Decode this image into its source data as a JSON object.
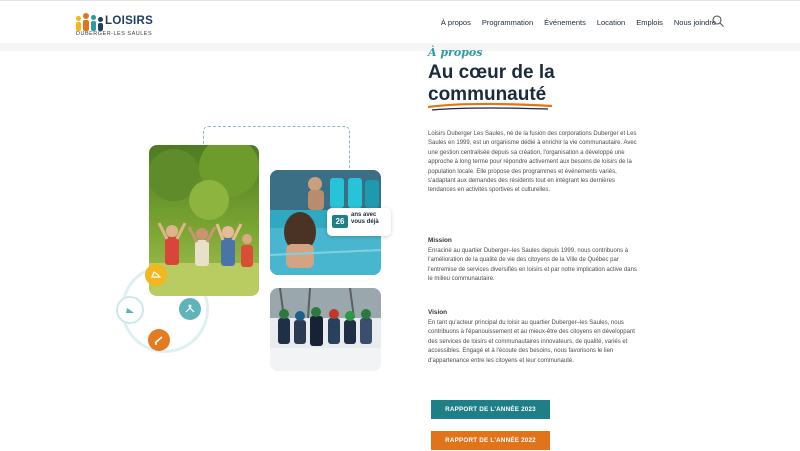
{
  "header": {
    "logo_title": "LOISIRS",
    "logo_subtitle": "DUBERGER-LES SAULES",
    "nav": [
      "À propos",
      "Programmation",
      "Événements",
      "Location",
      "Emplois",
      "Nous joindre"
    ]
  },
  "hero": {
    "eyebrow": "À propos",
    "title_line1": "Au cœur de la",
    "title_line2": "communauté",
    "intro": "Loisirs Duberger Les Saules, né de la fusion des corporations Duberger et Les Saules en 1999, est un organisme dédié à enrichir la vie communautaire. Avec une gestion centralisée depuis sa création, l'organisation a développé une approche à long terme pour répondre activement aux besoins de loisirs de la population locale. Elle propose des programmes et événements variés, s'adaptant aux demandes des résidents tout en intégrant les dernières tendances en activités sportives et culturelles.",
    "mission_heading": "Mission",
    "mission_text": "Enraciné au quartier Duberger–les Saules depuis 1999, nous contribuons à l'amélioration de la qualité de vie des citoyens de la Ville de Québec par l'entremise de services diversifiés en loisirs et par notre implication active dans le milieu communautaire.",
    "vision_heading": "Vision",
    "vision_text": "En tant qu'acteur principal du loisir au quartier Duberger–les Saules, nous contribuons à l'épanouissement et au mieux-être des citoyens en développant des services de loisirs et communautaires innovateurs, de qualité, variés et accessibles. Engagé et à l'écoute des besoins, nous favorisons le lien d'appartenance entre les citoyens et leur communauté.",
    "buttons": {
      "report_2023": "RAPPORT DE L'ANNÉE 2023",
      "report_2022": "RAPPORT DE L'ANNÉE 2022"
    }
  },
  "badge": {
    "number": "26",
    "text": "ans avec vous déjà"
  },
  "colors": {
    "teal": "#1e7f86",
    "orange": "#e0741b",
    "navy": "#1b2a3c",
    "yellow": "#f3b61c"
  },
  "icons": [
    "search-icon",
    "running-shoe-icon",
    "yoga-icon",
    "shoe-icon",
    "skate-icon"
  ]
}
